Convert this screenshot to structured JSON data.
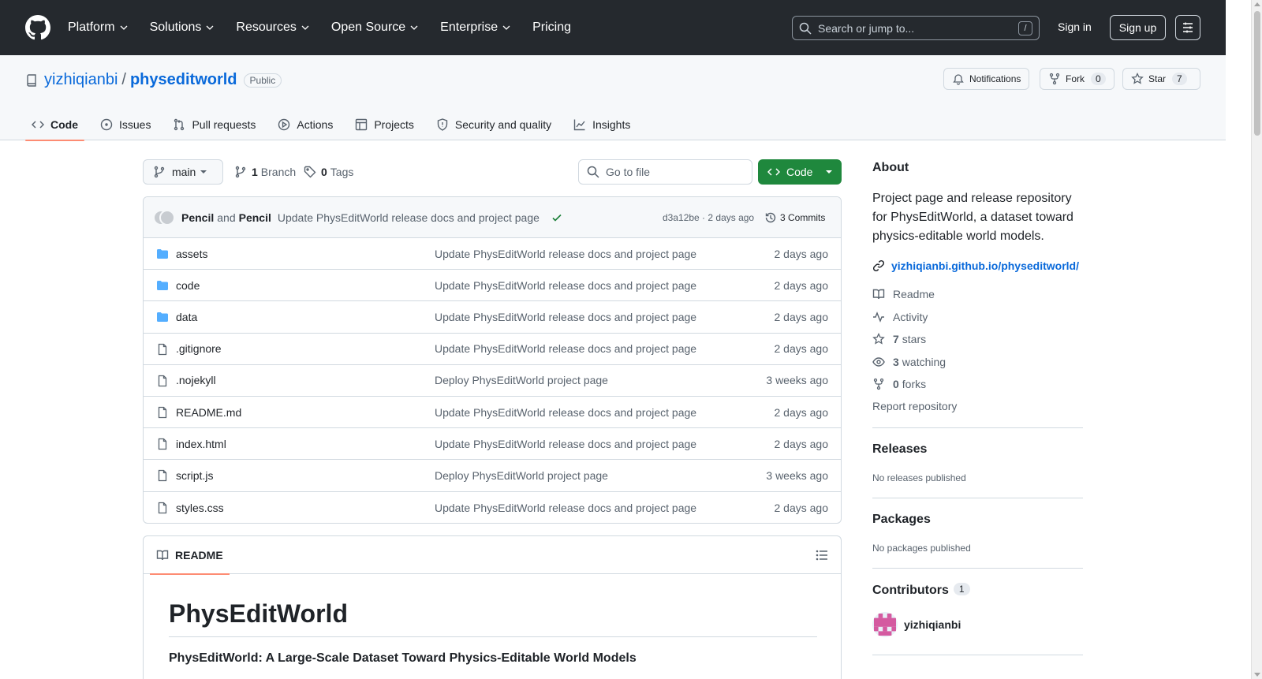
{
  "header": {
    "nav": [
      "Platform",
      "Solutions",
      "Resources",
      "Open Source",
      "Enterprise",
      "Pricing"
    ],
    "search_placeholder": "Search or jump to...",
    "search_shortcut": "/",
    "sign_in": "Sign in",
    "sign_up": "Sign up"
  },
  "repo": {
    "owner": "yizhiqianbi",
    "separator": "/",
    "name": "physeditworld",
    "visibility": "Public",
    "notifications_label": "Notifications",
    "fork_label": "Fork",
    "fork_count": "0",
    "star_label": "Star",
    "star_count": "7"
  },
  "tabs": [
    {
      "label": "Code",
      "icon": "code-icon",
      "active": true
    },
    {
      "label": "Issues",
      "icon": "issue-icon"
    },
    {
      "label": "Pull requests",
      "icon": "pull-request-icon"
    },
    {
      "label": "Actions",
      "icon": "play-icon"
    },
    {
      "label": "Projects",
      "icon": "table-icon"
    },
    {
      "label": "Security and quality",
      "icon": "shield-icon"
    },
    {
      "label": "Insights",
      "icon": "graph-icon"
    }
  ],
  "branchbar": {
    "branch": "main",
    "branch_count": "1",
    "branch_label": "Branch",
    "tag_count": "0",
    "tag_label": "Tags",
    "goto_placeholder": "Go to file",
    "code_button": "Code"
  },
  "latest_commit": {
    "author1": "Pencil",
    "and": "and",
    "author2": "Pencil",
    "message": "Update PhysEditWorld release docs and project page",
    "sha": "d3a12be · 2 days ago",
    "commits_label": "3 Commits"
  },
  "files": [
    {
      "name": "assets",
      "type": "dir",
      "message": "Update PhysEditWorld release docs and project page",
      "age": "2 days ago"
    },
    {
      "name": "code",
      "type": "dir",
      "message": "Update PhysEditWorld release docs and project page",
      "age": "2 days ago"
    },
    {
      "name": "data",
      "type": "dir",
      "message": "Update PhysEditWorld release docs and project page",
      "age": "2 days ago"
    },
    {
      "name": ".gitignore",
      "type": "file",
      "message": "Update PhysEditWorld release docs and project page",
      "age": "2 days ago"
    },
    {
      "name": ".nojekyll",
      "type": "file",
      "message": "Deploy PhysEditWorld project page",
      "age": "3 weeks ago"
    },
    {
      "name": "README.md",
      "type": "file",
      "message": "Update PhysEditWorld release docs and project page",
      "age": "2 days ago"
    },
    {
      "name": "index.html",
      "type": "file",
      "message": "Update PhysEditWorld release docs and project page",
      "age": "2 days ago"
    },
    {
      "name": "script.js",
      "type": "file",
      "message": "Deploy PhysEditWorld project page",
      "age": "3 weeks ago"
    },
    {
      "name": "styles.css",
      "type": "file",
      "message": "Update PhysEditWorld release docs and project page",
      "age": "2 days ago"
    }
  ],
  "readme": {
    "tab_label": "README",
    "h1": "PhysEditWorld",
    "subtitle": "PhysEditWorld: A Large-Scale Dataset Toward Physics-Editable World Models"
  },
  "about": {
    "heading": "About",
    "description": "Project page and release repository for PhysEditWorld, a dataset toward physics-editable world models.",
    "homepage": "yizhiqianbi.github.io/physeditworld/",
    "readme": "Readme",
    "activity": "Activity",
    "stars_count": "7",
    "stars_label": "stars",
    "watching_count": "3",
    "watching_label": "watching",
    "forks_count": "0",
    "forks_label": "forks",
    "report": "Report repository"
  },
  "releases": {
    "heading": "Releases",
    "empty": "No releases published"
  },
  "packages": {
    "heading": "Packages",
    "empty": "No packages published"
  },
  "contributors": {
    "heading": "Contributors",
    "count": "1",
    "user": "yizhiqianbi"
  },
  "colors": {
    "accent": "#0969da",
    "primary_button": "#1f883d",
    "header_bg": "#25292e",
    "tab_underline": "#fd8c73"
  }
}
